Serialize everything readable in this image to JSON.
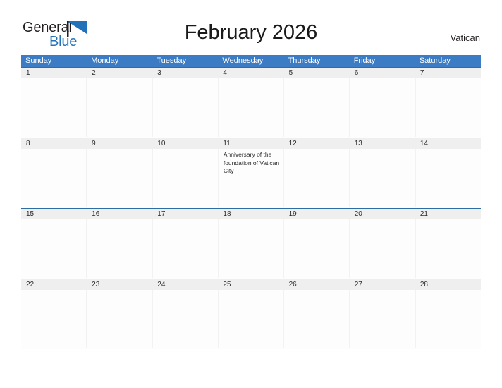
{
  "branding": {
    "logo_text_primary": "General",
    "logo_text_secondary": "Blue",
    "logo_icon": "blue-flag-triangle-icon",
    "accent_blue": "#2372b9"
  },
  "header": {
    "title": "February 2026",
    "region": "Vatican"
  },
  "colors": {
    "header_band": "#3b7cc4",
    "row_divider": "#2e6da4",
    "date_band": "#efefef",
    "text_dark": "#231f20"
  },
  "calendar": {
    "month": "February",
    "year": "2026",
    "weekday_headers": [
      "Sunday",
      "Monday",
      "Tuesday",
      "Wednesday",
      "Thursday",
      "Friday",
      "Saturday"
    ],
    "weeks": [
      {
        "days": [
          {
            "number": "1",
            "events": []
          },
          {
            "number": "2",
            "events": []
          },
          {
            "number": "3",
            "events": []
          },
          {
            "number": "4",
            "events": []
          },
          {
            "number": "5",
            "events": []
          },
          {
            "number": "6",
            "events": []
          },
          {
            "number": "7",
            "events": []
          }
        ]
      },
      {
        "days": [
          {
            "number": "8",
            "events": []
          },
          {
            "number": "9",
            "events": []
          },
          {
            "number": "10",
            "events": []
          },
          {
            "number": "11",
            "events": [
              "Anniversary of the foundation of Vatican City"
            ]
          },
          {
            "number": "12",
            "events": []
          },
          {
            "number": "13",
            "events": []
          },
          {
            "number": "14",
            "events": []
          }
        ]
      },
      {
        "days": [
          {
            "number": "15",
            "events": []
          },
          {
            "number": "16",
            "events": []
          },
          {
            "number": "17",
            "events": []
          },
          {
            "number": "18",
            "events": []
          },
          {
            "number": "19",
            "events": []
          },
          {
            "number": "20",
            "events": []
          },
          {
            "number": "21",
            "events": []
          }
        ]
      },
      {
        "days": [
          {
            "number": "22",
            "events": []
          },
          {
            "number": "23",
            "events": []
          },
          {
            "number": "24",
            "events": []
          },
          {
            "number": "25",
            "events": []
          },
          {
            "number": "26",
            "events": []
          },
          {
            "number": "27",
            "events": []
          },
          {
            "number": "28",
            "events": []
          }
        ]
      }
    ]
  }
}
